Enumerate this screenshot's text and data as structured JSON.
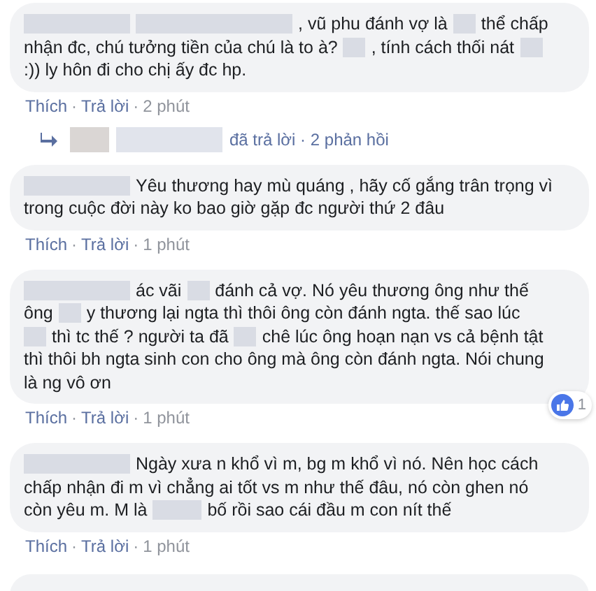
{
  "comments": [
    {
      "kind": "comment",
      "lines": [
        [
          {
            "kind": "name"
          },
          {
            "kind": "wide"
          },
          {
            "kind": "text",
            "text": ", vũ phu đánh vợ là"
          },
          {
            "kind": "word"
          },
          {
            "kind": "text",
            "text": "thể chấp"
          }
        ],
        [
          {
            "kind": "text",
            "text": "nhận đc, chú tưởng tiền của chú là to à?"
          },
          {
            "kind": "word"
          },
          {
            "kind": "text",
            "text": ", tính cách thối nát"
          },
          {
            "kind": "word"
          }
        ],
        [
          {
            "kind": "text",
            "text": ":)) ly hôn đi cho chị ấy đc hp."
          }
        ]
      ],
      "actions": {
        "like": "Thích",
        "sep1": "·",
        "reply": "Trả lời",
        "sep2": "·",
        "time": "2 phút"
      },
      "replies": {
        "text": "đã trả lời · 2 phản hồi"
      }
    },
    {
      "kind": "comment",
      "lines": [
        [
          {
            "kind": "name"
          },
          {
            "kind": "text",
            "text": "Yêu thương hay mù quáng , hãy cố gắng trân trọng vì"
          }
        ],
        [
          {
            "kind": "text",
            "text": "trong cuộc đời này ko bao giờ gặp đc người thứ 2 đâu"
          }
        ]
      ],
      "actions": {
        "like": "Thích",
        "sep1": "·",
        "reply": "Trả lời",
        "sep2": "·",
        "time": "1 phút"
      }
    },
    {
      "kind": "comment",
      "lines": [
        [
          {
            "kind": "name"
          },
          {
            "kind": "text",
            "text": "ác vãi"
          },
          {
            "kind": "word"
          },
          {
            "kind": "text",
            "text": "đánh cả vợ. Nó yêu thương ông như thế"
          }
        ],
        [
          {
            "kind": "text",
            "text": "ông"
          },
          {
            "kind": "word"
          },
          {
            "kind": "text",
            "text": "y thương lại ngta thì thôi ông còn đánh ngta. thế sao lúc"
          }
        ],
        [
          {
            "kind": "word"
          },
          {
            "kind": "text",
            "text": "thì tc thế ? người ta đã"
          },
          {
            "kind": "word"
          },
          {
            "kind": "text",
            "text": "chê lúc ông hoạn nạn vs cả bệnh tật"
          }
        ],
        [
          {
            "kind": "text",
            "text": "thì thôi bh ngta sinh con cho ông mà ông còn đánh ngta. Nói chung"
          }
        ],
        [
          {
            "kind": "text",
            "text": "là ng vô ơn"
          }
        ]
      ],
      "actions": {
        "like": "Thích",
        "sep1": "·",
        "reply": "Trả lời",
        "sep2": "·",
        "time": "1 phút"
      },
      "reaction": {
        "count": "1"
      }
    },
    {
      "kind": "comment",
      "lines": [
        [
          {
            "kind": "name"
          },
          {
            "kind": "text",
            "text": "Ngày xưa n khổ vì m, bg m khổ vì nó. Nên học cách"
          }
        ],
        [
          {
            "kind": "text",
            "text": "chấp nhận đi m vì chẳng ai tốt vs m như thế đâu, nó còn ghen nó"
          }
        ],
        [
          {
            "kind": "text",
            "text": "còn yêu m. M là"
          },
          {
            "kind": "mid"
          },
          {
            "kind": "text",
            "text": "bố rồi sao cái đầu m con nít thế"
          }
        ]
      ],
      "actions": {
        "like": "Thích",
        "sep1": "·",
        "reply": "Trả lời",
        "sep2": "·",
        "time": "1 phút"
      }
    },
    {
      "kind": "partial"
    }
  ]
}
